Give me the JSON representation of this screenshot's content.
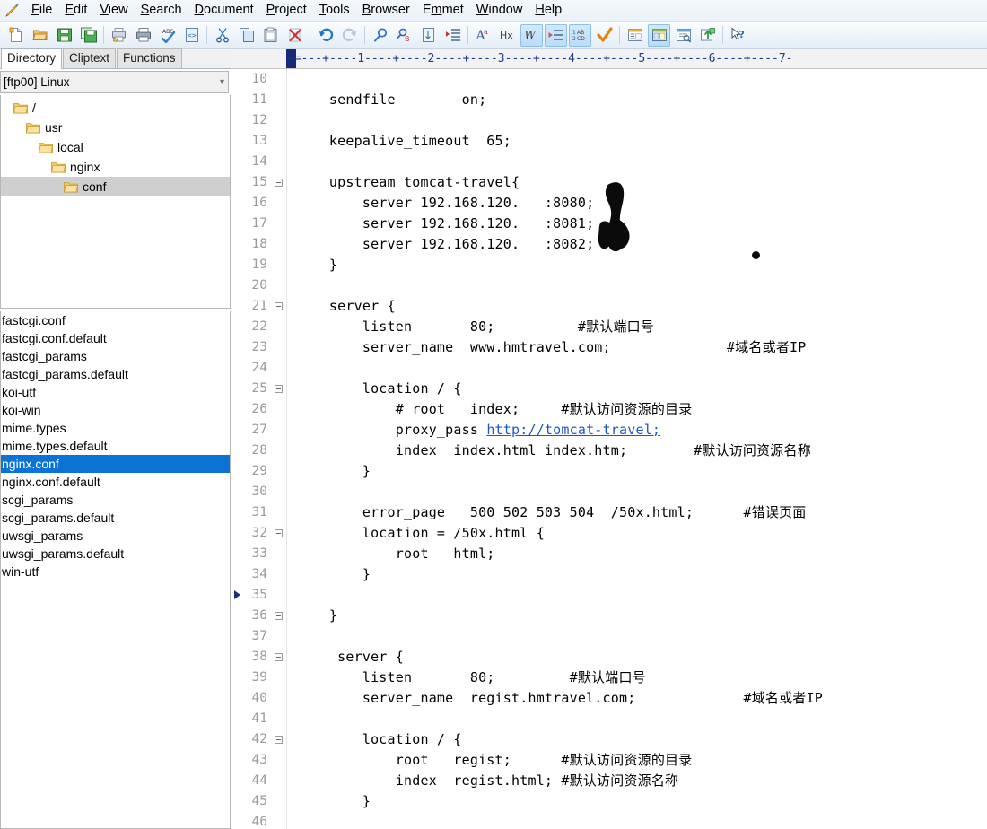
{
  "window": {
    "app_icon": "pencil-icon"
  },
  "menu": {
    "items": [
      {
        "label": "File",
        "mnemonic": "F"
      },
      {
        "label": "Edit",
        "mnemonic": "E"
      },
      {
        "label": "View",
        "mnemonic": "V"
      },
      {
        "label": "Search",
        "mnemonic": "S"
      },
      {
        "label": "Document",
        "mnemonic": "D"
      },
      {
        "label": "Project",
        "mnemonic": "P"
      },
      {
        "label": "Tools",
        "mnemonic": "T"
      },
      {
        "label": "Browser",
        "mnemonic": "B"
      },
      {
        "label": "Emmet",
        "mnemonic": "m"
      },
      {
        "label": "Window",
        "mnemonic": "W"
      },
      {
        "label": "Help",
        "mnemonic": "H"
      }
    ]
  },
  "toolbar": {
    "buttons": [
      {
        "name": "new-file-icon",
        "tip": "New"
      },
      {
        "name": "open-file-icon",
        "tip": "Open"
      },
      {
        "name": "save-icon",
        "tip": "Save"
      },
      {
        "name": "save-all-icon",
        "tip": "Save All"
      },
      {
        "sep": true
      },
      {
        "name": "print-preview-icon",
        "tip": "Print Preview"
      },
      {
        "name": "print-icon",
        "tip": "Print"
      },
      {
        "name": "spell-check-icon",
        "tip": "Spell Check"
      },
      {
        "name": "view-source-icon",
        "tip": "View in Browser"
      },
      {
        "sep": true
      },
      {
        "name": "cut-icon",
        "tip": "Cut"
      },
      {
        "name": "copy-icon",
        "tip": "Copy"
      },
      {
        "name": "paste-icon",
        "tip": "Paste"
      },
      {
        "name": "delete-icon",
        "tip": "Delete"
      },
      {
        "sep": true
      },
      {
        "name": "undo-icon",
        "tip": "Undo"
      },
      {
        "name": "redo-icon",
        "tip": "Redo"
      },
      {
        "sep": true
      },
      {
        "name": "find-icon",
        "tip": "Find"
      },
      {
        "name": "replace-icon",
        "tip": "Replace"
      },
      {
        "name": "goto-icon",
        "tip": "Go To"
      },
      {
        "name": "indent-icon",
        "tip": "Indent"
      },
      {
        "sep": true
      },
      {
        "name": "font-icon",
        "tip": "Font"
      },
      {
        "name": "hex-icon",
        "tip": "Hex Viewer"
      },
      {
        "name": "word-wrap-icon",
        "tip": "Word Wrap",
        "active": true
      },
      {
        "name": "show-spaces-icon",
        "tip": "Show Spaces",
        "active": true
      },
      {
        "name": "line-numbers-icon",
        "tip": "Line Numbers",
        "active": true
      },
      {
        "name": "check-icon",
        "tip": "Validate"
      },
      {
        "sep": true
      },
      {
        "name": "document-selector-icon",
        "tip": "Document Selector"
      },
      {
        "name": "directory-window-icon",
        "tip": "Directory Window",
        "active": true
      },
      {
        "name": "output-window-icon",
        "tip": "Output Window"
      },
      {
        "name": "ftp-upload-icon",
        "tip": "FTP Upload"
      },
      {
        "sep": true
      },
      {
        "name": "help-pointer-icon",
        "tip": "Context Help"
      }
    ]
  },
  "left_panel": {
    "tabs": [
      {
        "label": "Directory",
        "selected": true
      },
      {
        "label": "Cliptext",
        "selected": false
      },
      {
        "label": "Functions",
        "selected": false
      }
    ],
    "dropdown": {
      "value": "[ftp00] Linux",
      "caret": "chevron-down-icon"
    },
    "tree": [
      {
        "label": "/",
        "depth": 0,
        "selected": false
      },
      {
        "label": "usr",
        "depth": 1,
        "selected": false
      },
      {
        "label": "local",
        "depth": 2,
        "selected": false
      },
      {
        "label": "nginx",
        "depth": 3,
        "selected": false
      },
      {
        "label": "conf",
        "depth": 4,
        "selected": true
      }
    ],
    "files": [
      {
        "name": "fastcgi.conf",
        "selected": false
      },
      {
        "name": "fastcgi.conf.default",
        "selected": false
      },
      {
        "name": "fastcgi_params",
        "selected": false
      },
      {
        "name": "fastcgi_params.default",
        "selected": false
      },
      {
        "name": "koi-utf",
        "selected": false
      },
      {
        "name": "koi-win",
        "selected": false
      },
      {
        "name": "mime.types",
        "selected": false
      },
      {
        "name": "mime.types.default",
        "selected": false
      },
      {
        "name": "nginx.conf",
        "selected": true
      },
      {
        "name": "nginx.conf.default",
        "selected": false
      },
      {
        "name": "scgi_params",
        "selected": false
      },
      {
        "name": "scgi_params.default",
        "selected": false
      },
      {
        "name": "uwsgi_params",
        "selected": false
      },
      {
        "name": "uwsgi_params.default",
        "selected": false
      },
      {
        "name": "win-utf",
        "selected": false
      }
    ]
  },
  "editor": {
    "ruler": "-=---+----1----+----2----+----3----+----4----+----5----+----6----+----7-",
    "first_line": 10,
    "accent_selection": "#0a73d4",
    "link_color": "#1a57c8",
    "lines": [
      {
        "n": 10,
        "fold": false,
        "bookmark": false,
        "text": ""
      },
      {
        "n": 11,
        "fold": false,
        "bookmark": false,
        "text": "    sendfile        on;"
      },
      {
        "n": 12,
        "fold": false,
        "bookmark": false,
        "text": ""
      },
      {
        "n": 13,
        "fold": false,
        "bookmark": false,
        "text": "    keepalive_timeout  65;"
      },
      {
        "n": 14,
        "fold": false,
        "bookmark": false,
        "text": ""
      },
      {
        "n": 15,
        "fold": true,
        "bookmark": false,
        "text": "    upstream tomcat-travel{"
      },
      {
        "n": 16,
        "fold": false,
        "bookmark": false,
        "text": "        server 192.168.120.   :8080;"
      },
      {
        "n": 17,
        "fold": false,
        "bookmark": false,
        "text": "        server 192.168.120.   :8081;"
      },
      {
        "n": 18,
        "fold": false,
        "bookmark": false,
        "text": "        server 192.168.120.   :8082;"
      },
      {
        "n": 19,
        "fold": false,
        "bookmark": false,
        "text": "    }"
      },
      {
        "n": 20,
        "fold": false,
        "bookmark": false,
        "text": ""
      },
      {
        "n": 21,
        "fold": true,
        "bookmark": false,
        "text": "    server {"
      },
      {
        "n": 22,
        "fold": false,
        "bookmark": false,
        "text": "        listen       80;          #默认端口号"
      },
      {
        "n": 23,
        "fold": false,
        "bookmark": false,
        "text": "        server_name  www.hmtravel.com;              #域名或者IP"
      },
      {
        "n": 24,
        "fold": false,
        "bookmark": false,
        "text": ""
      },
      {
        "n": 25,
        "fold": true,
        "bookmark": false,
        "text": "        location / {"
      },
      {
        "n": 26,
        "fold": false,
        "bookmark": false,
        "text": "            # root   index;     #默认访问资源的目录"
      },
      {
        "n": 27,
        "fold": false,
        "bookmark": false,
        "text": "            proxy_pass http://tomcat-travel;",
        "link": "http://tomcat-travel;",
        "link_start": 23
      },
      {
        "n": 28,
        "fold": false,
        "bookmark": false,
        "text": "            index  index.html index.htm;        #默认访问资源名称"
      },
      {
        "n": 29,
        "fold": false,
        "bookmark": false,
        "text": "        }"
      },
      {
        "n": 30,
        "fold": false,
        "bookmark": false,
        "text": ""
      },
      {
        "n": 31,
        "fold": false,
        "bookmark": false,
        "text": "        error_page   500 502 503 504  /50x.html;      #错误页面"
      },
      {
        "n": 32,
        "fold": true,
        "bookmark": false,
        "text": "        location = /50x.html {"
      },
      {
        "n": 33,
        "fold": false,
        "bookmark": false,
        "text": "            root   html;"
      },
      {
        "n": 34,
        "fold": false,
        "bookmark": false,
        "text": "        }"
      },
      {
        "n": 35,
        "fold": false,
        "bookmark": true,
        "text": ""
      },
      {
        "n": 36,
        "fold": true,
        "bookmark": false,
        "text": "    }"
      },
      {
        "n": 37,
        "fold": false,
        "bookmark": false,
        "text": ""
      },
      {
        "n": 38,
        "fold": true,
        "bookmark": false,
        "text": "     server {"
      },
      {
        "n": 39,
        "fold": false,
        "bookmark": false,
        "text": "        listen       80;         #默认端口号"
      },
      {
        "n": 40,
        "fold": false,
        "bookmark": false,
        "text": "        server_name  regist.hmtravel.com;             #域名或者IP"
      },
      {
        "n": 41,
        "fold": false,
        "bookmark": false,
        "text": ""
      },
      {
        "n": 42,
        "fold": true,
        "bookmark": false,
        "text": "        location / {"
      },
      {
        "n": 43,
        "fold": false,
        "bookmark": false,
        "text": "            root   regist;      #默认访问资源的目录"
      },
      {
        "n": 44,
        "fold": false,
        "bookmark": false,
        "text": "            index  regist.html; #默认访问资源名称"
      },
      {
        "n": 45,
        "fold": false,
        "bookmark": false,
        "text": "        }"
      },
      {
        "n": 46,
        "fold": false,
        "bookmark": false,
        "text": ""
      }
    ],
    "annotations": [
      {
        "name": "redaction-scribble",
        "type": "redaction"
      },
      {
        "name": "ink-dot",
        "type": "dot"
      }
    ]
  }
}
